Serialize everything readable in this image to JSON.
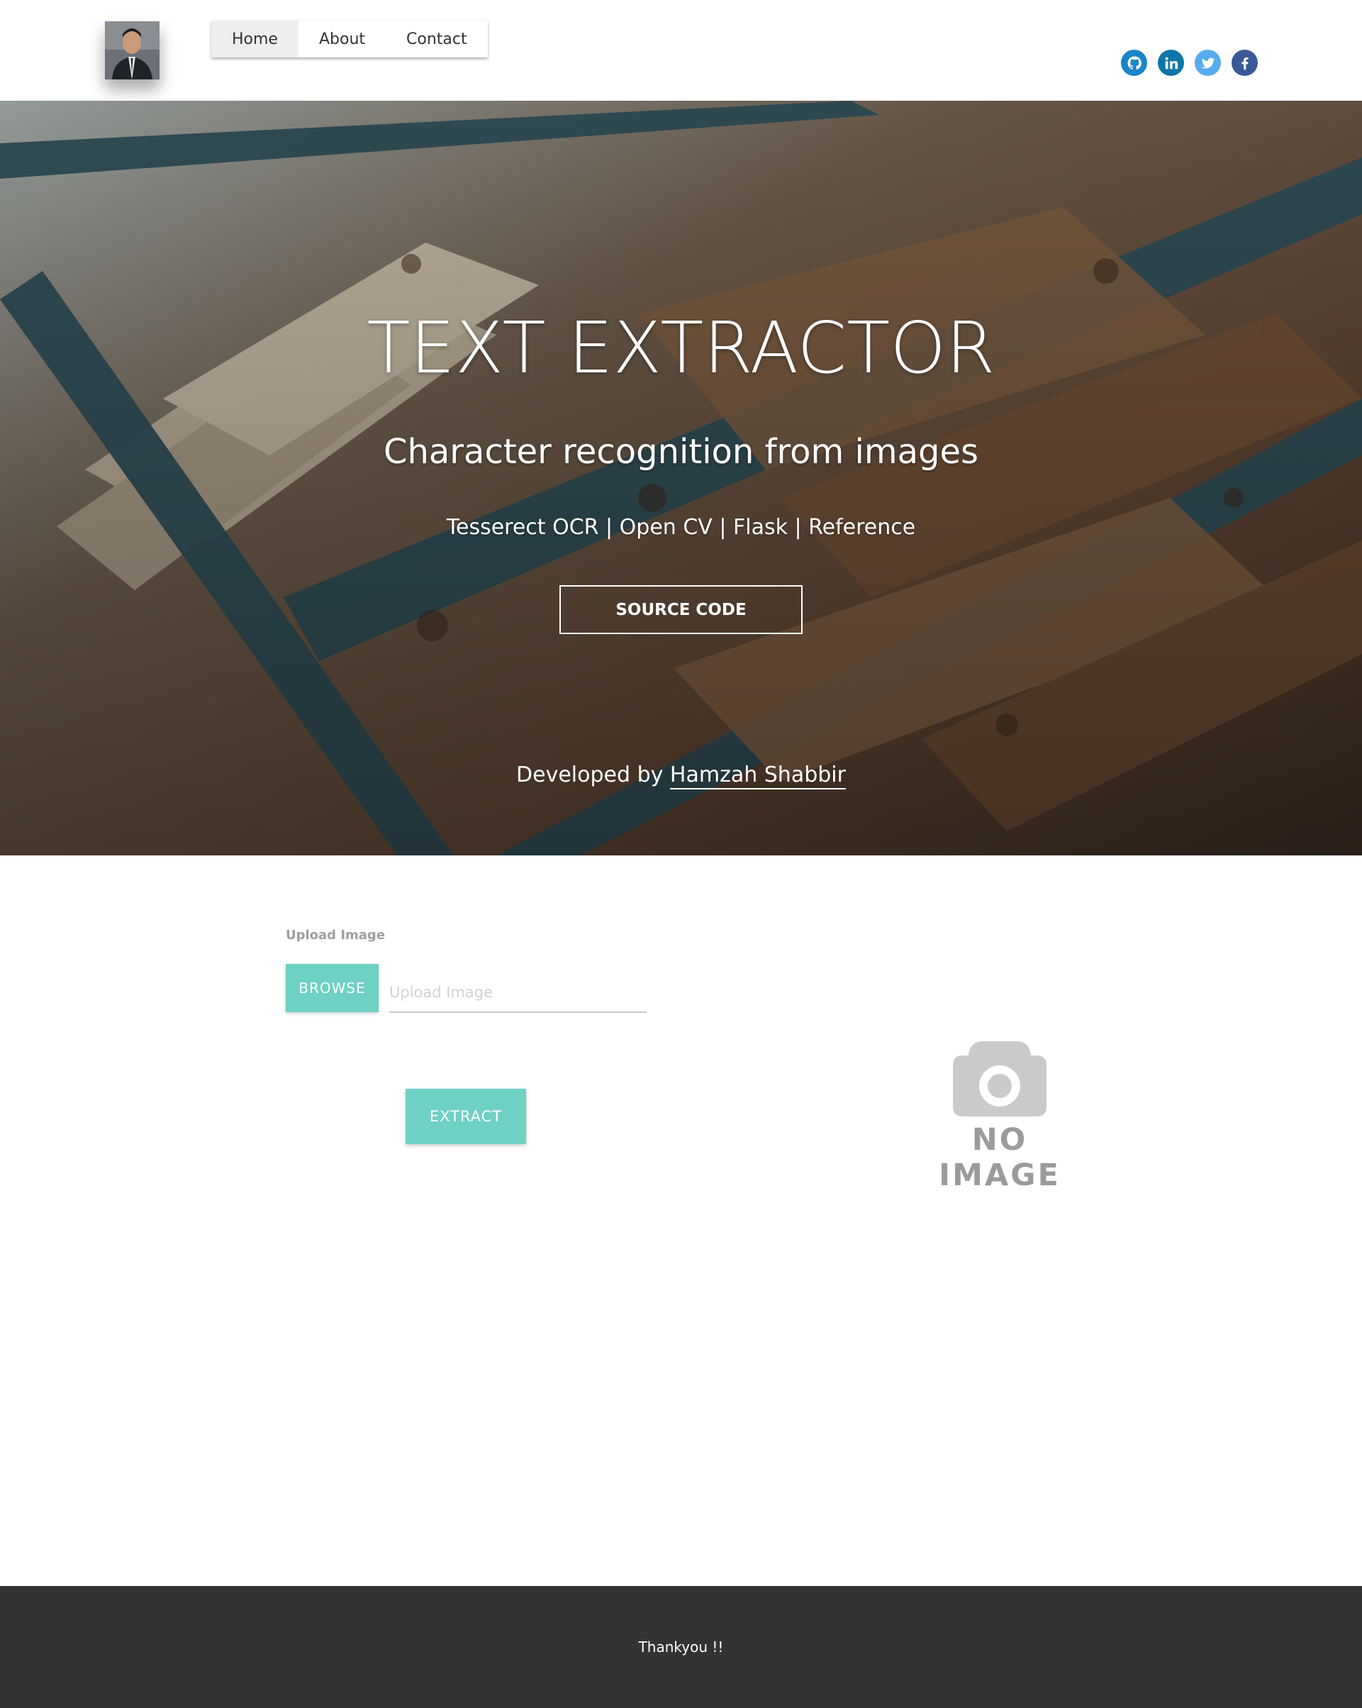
{
  "nav": {
    "items": [
      {
        "label": "Home",
        "active": true
      },
      {
        "label": "About",
        "active": false
      },
      {
        "label": "Contact",
        "active": false
      }
    ]
  },
  "social": [
    {
      "name": "github-icon",
      "color": "#1a85c8"
    },
    {
      "name": "linkedin-icon",
      "color": "#0e76a8"
    },
    {
      "name": "twitter-icon",
      "color": "#55acee"
    },
    {
      "name": "facebook-icon",
      "color": "#3b5998"
    }
  ],
  "hero": {
    "title": "TEXT EXTRACTOR",
    "subtitle": "Character recognition from images",
    "tech": "Tesserect OCR | Open CV | Flask | Reference",
    "source_button": "SOURCE CODE",
    "developed_by": "Developed by",
    "developer_name": "Hamzah Shabbir"
  },
  "upload": {
    "label": "Upload Image",
    "browse_label": "BROWSE",
    "input_placeholder": "Upload Image",
    "input_value": "",
    "extract_label": "EXTRACT"
  },
  "preview": {
    "placeholder_text": "NO IMAGE",
    "icon": "camera-icon"
  },
  "footer": {
    "text": "Thankyou !!"
  },
  "colors": {
    "accent": "#6fd0c4",
    "footer_bg": "#333333",
    "placeholder_gray": "#cacaca"
  }
}
